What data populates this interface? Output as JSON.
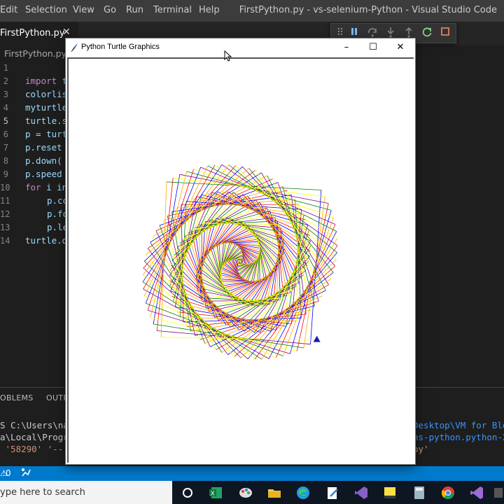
{
  "menubar": {
    "items": [
      "Edit",
      "Selection",
      "View",
      "Go",
      "Run",
      "Terminal",
      "Help"
    ],
    "window_title": "FirstPython.py - vs-selenium-Python - Visual Studio Code"
  },
  "tab": {
    "label": "FirstPython.py",
    "close": "✕"
  },
  "breadcrumb": "FirstPython.py",
  "line_numbers": [
    "1",
    "2",
    "3",
    "4",
    "5",
    "6",
    "7",
    "8",
    "9",
    "10",
    "11",
    "12",
    "13",
    "14"
  ],
  "code_lines": [
    {
      "text": "",
      "indent": ""
    },
    {
      "text": "import t",
      "kw": "import",
      "rest": " t",
      "indent": ""
    },
    {
      "text": "colorlis",
      "indent": ""
    },
    {
      "text": "myturtle",
      "indent": ""
    },
    {
      "text": "turtle.s",
      "indent": ""
    },
    {
      "text": "p = turt",
      "indent": ""
    },
    {
      "text": "p.reset",
      "indent": ""
    },
    {
      "text": "p.down(",
      "indent": ""
    },
    {
      "text": "p.speed",
      "indent": ""
    },
    {
      "text": "for i in",
      "kw": "for",
      "rest": " i in",
      "indent": ""
    },
    {
      "text": "p.co",
      "indent": "    "
    },
    {
      "text": "p.fo",
      "indent": "    "
    },
    {
      "text": "p.le",
      "indent": "    "
    },
    {
      "text": "turtle.d",
      "indent": ""
    }
  ],
  "panel": {
    "tab_problems": "OBLEMS",
    "tab_output": "OUTP"
  },
  "terminal": {
    "left_lines": [
      "S C:\\Users\\nap",
      "a\\Local\\Progr",
      " '58290' '--"
    ],
    "right_lines": [
      "Desktop\\VM for Blo",
      "ns-python.python-2",
      "py'"
    ]
  },
  "statusbar": {
    "errors": "0",
    "remote_icon": "live-share-icon"
  },
  "taskbar": {
    "search_placeholder": "ype here to search"
  },
  "turtle_window": {
    "title": "Python Turtle Graphics",
    "minimize": "–",
    "maximize": "☐",
    "close": "✕"
  },
  "colors": {
    "accent": "#007acc",
    "turtle_colors": [
      "#ff0000",
      "#800080",
      "#0000ff",
      "#008000",
      "#ffa500",
      "#ffff00"
    ]
  }
}
